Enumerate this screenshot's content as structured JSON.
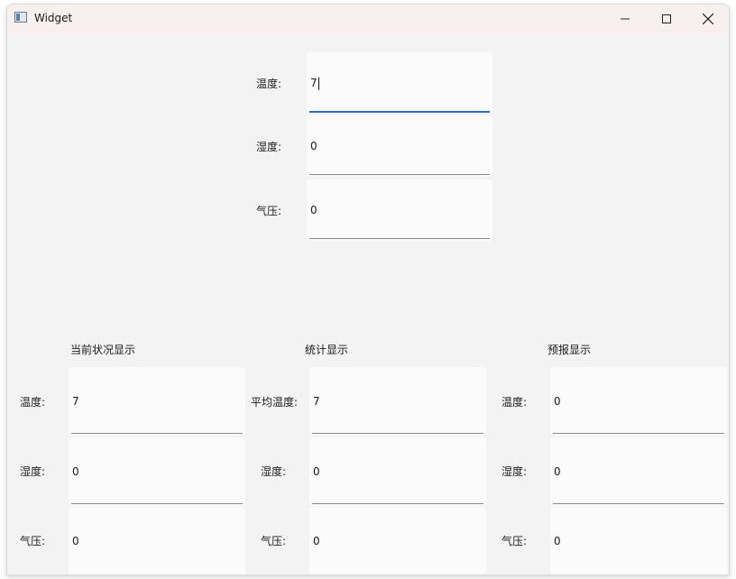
{
  "window": {
    "title": "Widget"
  },
  "titlebar_buttons": {
    "minimize": "–",
    "maximize": "☐",
    "close": "✕"
  },
  "input": {
    "temperature_label": "温度:",
    "temperature_value": "7",
    "humidity_label": "湿度:",
    "humidity_value": "0",
    "pressure_label": "气压:",
    "pressure_value": "0"
  },
  "current": {
    "title": "当前状况显示",
    "temperature_label": "温度:",
    "temperature_value": "7",
    "humidity_label": "湿度:",
    "humidity_value": "0",
    "pressure_label": "气压:",
    "pressure_value": "0"
  },
  "statistics": {
    "title": "统计显示",
    "avg_temperature_label": "平均温度:",
    "avg_temperature_value": "7",
    "humidity_label": "湿度:",
    "humidity_value": "0",
    "pressure_label": "气压:",
    "pressure_value": "0"
  },
  "forecast": {
    "title": "预报显示",
    "temperature_label": "温度:",
    "temperature_value": "0",
    "humidity_label": "湿度:",
    "humidity_value": "0",
    "pressure_label": "气压:",
    "pressure_value": "0"
  }
}
